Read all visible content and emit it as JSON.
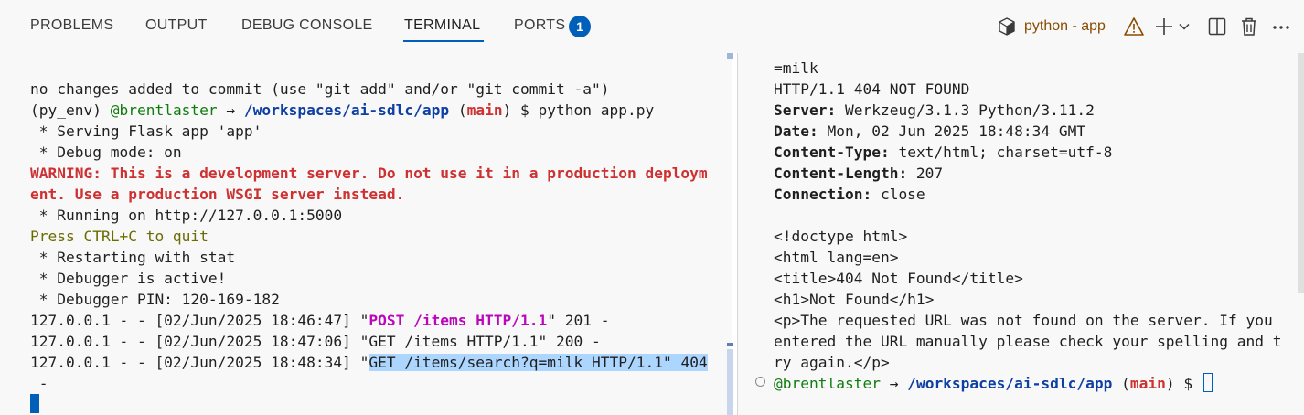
{
  "tabs": [
    {
      "label": "PROBLEMS"
    },
    {
      "label": "OUTPUT"
    },
    {
      "label": "DEBUG CONSOLE"
    },
    {
      "label": "TERMINAL"
    },
    {
      "label": "PORTS"
    }
  ],
  "ports_badge": "1",
  "terminal_name": "python - app",
  "icons": {
    "terminal": "terminal-icon",
    "warning": "warning-icon",
    "add": "plus-icon",
    "dropdown": "chevron-down-icon",
    "split": "split-icon",
    "delete": "trash-icon",
    "more": "ellipsis-icon"
  },
  "colors": {
    "accent": "#005fb8",
    "warning_text": "#cd3131",
    "path": "#0e3fa3",
    "user": "#107c10",
    "post": "#bc05bc",
    "highlight": "#add6ff"
  },
  "left_terminal": {
    "l1": "no changes added to commit (use \"git add\" and/or \"git commit -a\")",
    "l2_venv": "(py_env) ",
    "l2_user": "@brentlaster",
    "l2_arrow": " → ",
    "l2_path": "/workspaces/ai-sdlc/app",
    "l2_paren_open": " (",
    "l2_branch": "main",
    "l2_rest": ") $ python app.py",
    "l3": " * Serving Flask app 'app'",
    "l4": " * Debug mode: on",
    "l5": "WARNING: This is a development server. Do not use it in a production deploym",
    "l6": "ent. Use a production WSGI server instead.",
    "l7": " * Running on http://127.0.0.1:5000",
    "l8": "Press CTRL+C to quit",
    "l9": " * Restarting with stat",
    "l10": " * Debugger is active!",
    "l11": " * Debugger PIN: 120-169-182",
    "l12_a": "127.0.0.1 - - [02/Jun/2025 18:46:47] \"",
    "l12_b": "POST /items HTTP/1.1",
    "l12_c": "\" 201 -",
    "l13": "127.0.0.1 - - [02/Jun/2025 18:47:06] \"GET /items HTTP/1.1\" 200 -",
    "l14_a": "127.0.0.1 - - [02/Jun/2025 18:48:34] \"",
    "l14_b": "GET /items/search?q=milk HTTP/1.1\" 404",
    "l15": " -"
  },
  "right_terminal": {
    "r1": "=milk",
    "r2": "HTTP/1.1 404 NOT FOUND",
    "r3_k": "Server:",
    "r3_v": " Werkzeug/3.1.3 Python/3.11.2",
    "r4_k": "Date:",
    "r4_v": " Mon, 02 Jun 2025 18:48:34 GMT",
    "r5_k": "Content-Type:",
    "r5_v": " text/html; charset=utf-8",
    "r6_k": "Content-Length:",
    "r6_v": " 207",
    "r7_k": "Connection:",
    "r7_v": " close",
    "r8": "<!doctype html>",
    "r9": "<html lang=en>",
    "r10": "<title>404 Not Found</title>",
    "r11": "<h1>Not Found</h1>",
    "r12": "<p>The requested URL was not found on the server. If you",
    "r13": "entered the URL manually please check your spelling and t",
    "r14": "ry again.</p>",
    "r15_user": "@brentlaster",
    "r15_arrow": " → ",
    "r15_path": "/workspaces/ai-sdlc/app",
    "r15_paren_open": " (",
    "r15_branch": "main",
    "r15_rest": ") $ "
  }
}
